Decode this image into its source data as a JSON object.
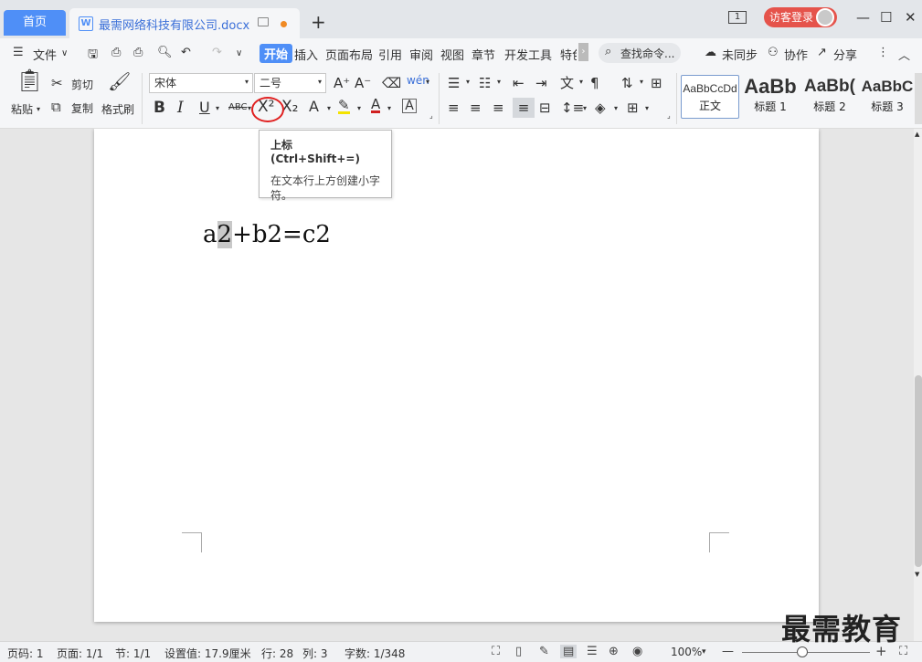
{
  "tabs": {
    "home": "首页",
    "doc": "最需网络科技有限公司.docx",
    "add": "+"
  },
  "topright": {
    "window_count": "1",
    "login": "访客登录"
  },
  "menu": {
    "file": "文件",
    "items": [
      "开始",
      "插入",
      "页面布局",
      "引用",
      "审阅",
      "视图",
      "章节",
      "开发工具",
      "特色"
    ],
    "search": "查找命令...",
    "sync": "未同步",
    "collab": "协作",
    "share": "分享"
  },
  "ribbon": {
    "paste": "粘贴",
    "cut": "剪切",
    "copy": "复制",
    "format_painter": "格式刷",
    "font_name": "宋体",
    "font_size": "二号",
    "styles": [
      {
        "preview": "AaBbCcDd",
        "label": "正文"
      },
      {
        "preview": "AaBb",
        "label": "标题 1"
      },
      {
        "preview": "AaBb(",
        "label": "标题 2"
      },
      {
        "preview": "AaBbC",
        "label": "标题 3"
      }
    ]
  },
  "tooltip": {
    "title": "上标 (Ctrl+Shift+=)",
    "desc": "在文本行上方创建小字符。"
  },
  "document": {
    "before": "a",
    "selected": "2",
    "after": "+b2=c2"
  },
  "status": {
    "page_num": "页码: 1",
    "pages": "页面: 1/1",
    "section": "节: 1/1",
    "setting": "设置值: 17.9厘米",
    "row": "行: 28",
    "col": "列: 3",
    "words": "字数: 1/348",
    "zoom": "100%"
  },
  "watermark": "最需教育",
  "colors": {
    "accent": "#4f8ff7",
    "login": "#e5534b",
    "highlight_circle": "#e02020"
  }
}
